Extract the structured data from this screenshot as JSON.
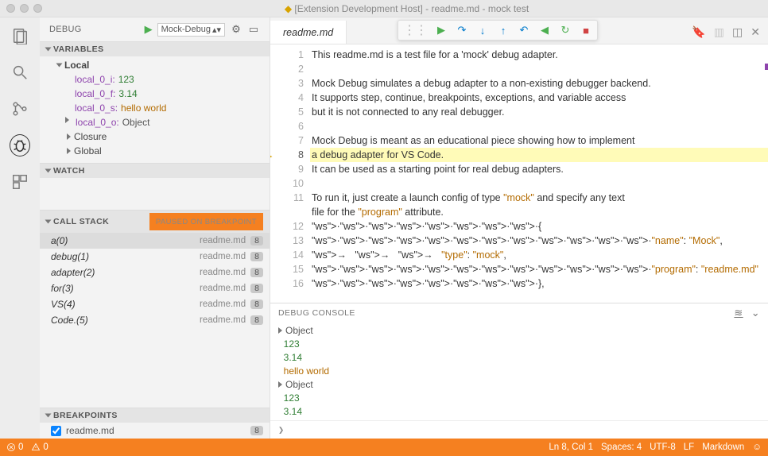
{
  "window": {
    "title": "[Extension Development Host] - readme.md - mock test"
  },
  "sidebar": {
    "debug_label": "DEBUG",
    "config_name": "Mock-Debug",
    "sections": {
      "variables": "VARIABLES",
      "watch": "WATCH",
      "callstack": "CALL STACK",
      "callstack_status": "PAUSED ON BREAKPOINT",
      "breakpoints": "BREAKPOINTS"
    },
    "scopes": {
      "local": "Local",
      "closure": "Closure",
      "global": "Global"
    },
    "locals": [
      {
        "k": "local_0_i:",
        "v": "123",
        "cls": "num"
      },
      {
        "k": "local_0_f:",
        "v": "3.14",
        "cls": "num"
      },
      {
        "k": "local_0_s:",
        "v": "hello world",
        "cls": "str"
      },
      {
        "k": "local_0_o:",
        "v": "Object",
        "cls": "obj"
      }
    ],
    "callstack": [
      {
        "fn": "a(0)",
        "file": "readme.md",
        "ln": "8"
      },
      {
        "fn": "debug(1)",
        "file": "readme.md",
        "ln": "8"
      },
      {
        "fn": "adapter(2)",
        "file": "readme.md",
        "ln": "8"
      },
      {
        "fn": "for(3)",
        "file": "readme.md",
        "ln": "8"
      },
      {
        "fn": "VS(4)",
        "file": "readme.md",
        "ln": "8"
      },
      {
        "fn": "Code.(5)",
        "file": "readme.md",
        "ln": "8"
      }
    ],
    "breakpoints": [
      {
        "file": "readme.md",
        "ln": "8"
      }
    ]
  },
  "editor": {
    "tab": "readme.md",
    "lines": [
      "This readme.md is a test file for a 'mock' debug adapter.",
      "",
      "Mock Debug simulates a debug adapter to a non-existing debugger backend.",
      "It supports step, continue, breakpoints, exceptions, and variable access",
      "but it is not connected to any real debugger.",
      "",
      "Mock Debug is meant as an educational piece showing how to implement",
      "a debug adapter for VS Code.",
      "It can be used as a starting point for real debug adapters.",
      "",
      "To run it, just create a launch config of type \"mock\" and specify any text",
      "file for the \"program\" attribute.",
      "········{",
      "············\"name\": \"Mock\",",
      "→   →   →   \"type\": \"mock\",",
      "············\"program\": \"readme.md\"",
      "········},"
    ],
    "highlight_line": 8,
    "gutter_start": 1,
    "gutter_end": 16
  },
  "console": {
    "title": "DEBUG CONSOLE",
    "lines": [
      {
        "t": "Object",
        "cls": "obj",
        "exp": true
      },
      {
        "t": "123",
        "cls": "num",
        "exp": false
      },
      {
        "t": "3.14",
        "cls": "num",
        "exp": false
      },
      {
        "t": "hello world",
        "cls": "str",
        "exp": false
      },
      {
        "t": "Object",
        "cls": "obj",
        "exp": true
      },
      {
        "t": "123",
        "cls": "num",
        "exp": false
      },
      {
        "t": "3.14",
        "cls": "num",
        "exp": false
      }
    ],
    "prompt": "❯"
  },
  "statusbar": {
    "errors": "0",
    "warnings": "0",
    "ln_col": "Ln 8, Col 1",
    "spaces": "Spaces: 4",
    "encoding": "UTF-8",
    "eol": "LF",
    "lang": "Markdown"
  }
}
